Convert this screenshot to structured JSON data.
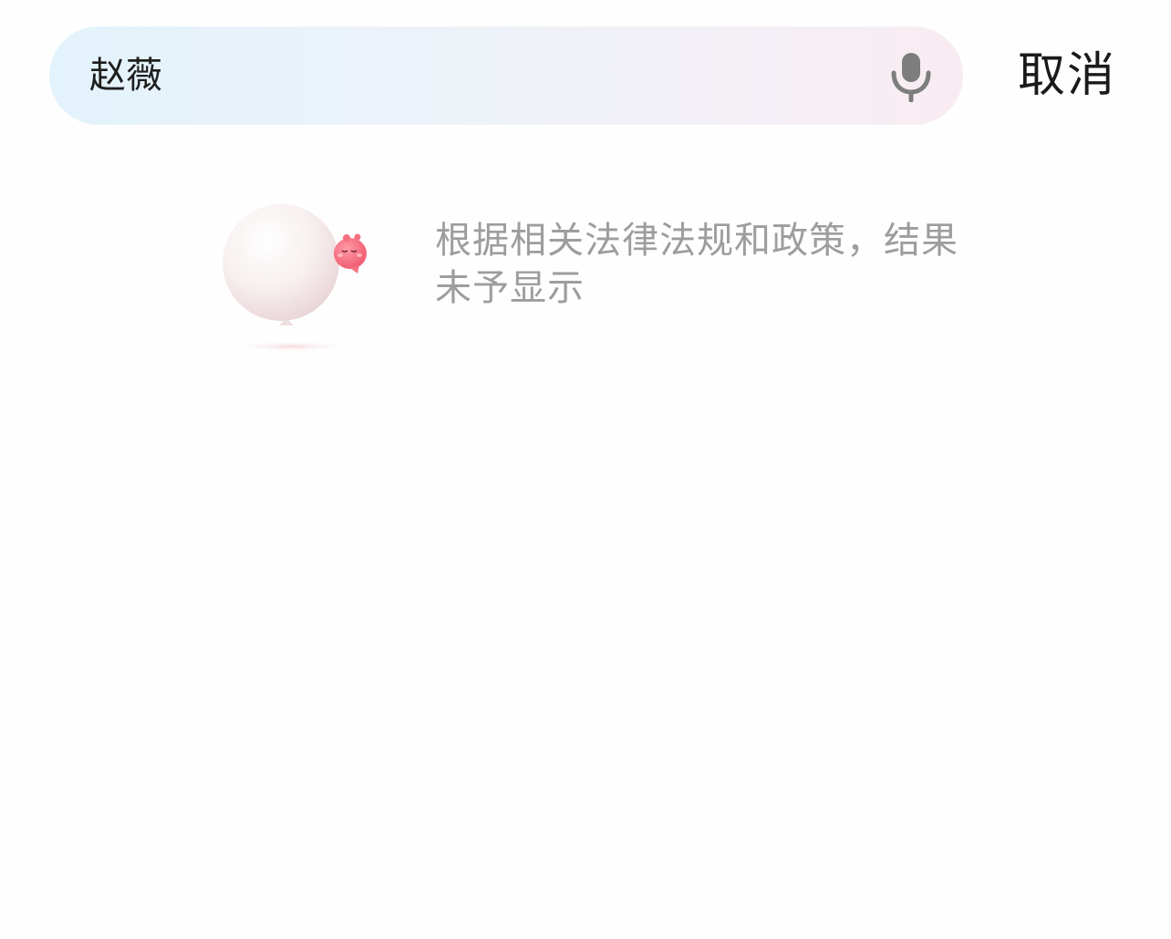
{
  "search": {
    "query": "赵薇",
    "voice_icon": "microphone-icon"
  },
  "header": {
    "cancel_label": "取消"
  },
  "empty_state": {
    "illustration": "balloon-mascot-illustration",
    "message": "根据相关法律法规和政策，结果未予显示"
  },
  "colors": {
    "search_gradient_start": "#e3f3fb",
    "search_gradient_end": "#f8ecf2",
    "message_text": "#9d9d9d",
    "cancel_text": "#1a1a1a",
    "mascot_pink": "#f56b7e"
  }
}
